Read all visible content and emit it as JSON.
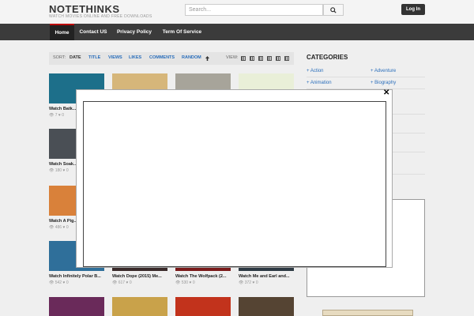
{
  "header": {
    "logo": "NOTETHINKS",
    "tagline": "WATCH MOVIES ONLINE AND FREE DOWNLOADS",
    "search_placeholder": "Search...",
    "login_label": "Log In"
  },
  "nav": [
    {
      "label": "Home",
      "active": true
    },
    {
      "label": "Contact US",
      "active": false
    },
    {
      "label": "Privacy Policy",
      "active": false
    },
    {
      "label": "Term Of Service",
      "active": false
    }
  ],
  "sortbar": {
    "sort_label": "SORT:",
    "items": [
      "DATE",
      "TITLE",
      "VIEWS",
      "LIKES",
      "COMMENTS",
      "RANDOM"
    ],
    "view_label": "VIEW:"
  },
  "movies": [
    {
      "title": "Watch Batk...",
      "views": "7",
      "likes": "0",
      "color": "#1d6f8a"
    },
    {
      "title": "",
      "views": "",
      "likes": "",
      "color": "#d6b67a"
    },
    {
      "title": "",
      "views": "",
      "likes": "",
      "color": "#a7a49a"
    },
    {
      "title": "",
      "views": "",
      "likes": "",
      "color": "#e9efd8"
    },
    {
      "title": "Watch Soak...",
      "views": "180",
      "likes": "0",
      "color": "#4a4f55"
    },
    {
      "title": "Watch A Pig...",
      "views": "486",
      "likes": "0",
      "color": "#d9813a"
    },
    {
      "title": "Watch Infinitely Polar B...",
      "views": "542",
      "likes": "0",
      "color": "#2f6f9a"
    },
    {
      "title": "Watch Dope (2015) Me...",
      "views": "617",
      "likes": "0",
      "color": "#3a2a2a"
    },
    {
      "title": "Watch The Wolfpack (2...",
      "views": "530",
      "likes": "0",
      "color": "#7a1a1a"
    },
    {
      "title": "Watch Me and Earl and...",
      "views": "372",
      "likes": "0",
      "color": "#2e3a44"
    },
    {
      "title": "",
      "views": "",
      "likes": "",
      "color": "#6a2a5a"
    },
    {
      "title": "",
      "views": "",
      "likes": "",
      "color": "#c9a24a"
    },
    {
      "title": "",
      "views": "",
      "likes": "",
      "color": "#c2331c"
    },
    {
      "title": "",
      "views": "",
      "likes": "",
      "color": "#554433"
    }
  ],
  "sidebar": {
    "title": "CATEGORIES",
    "categories": [
      "Action",
      "Adventure",
      "Animation",
      "Biography"
    ]
  },
  "modal": {
    "close_label": "✕"
  }
}
